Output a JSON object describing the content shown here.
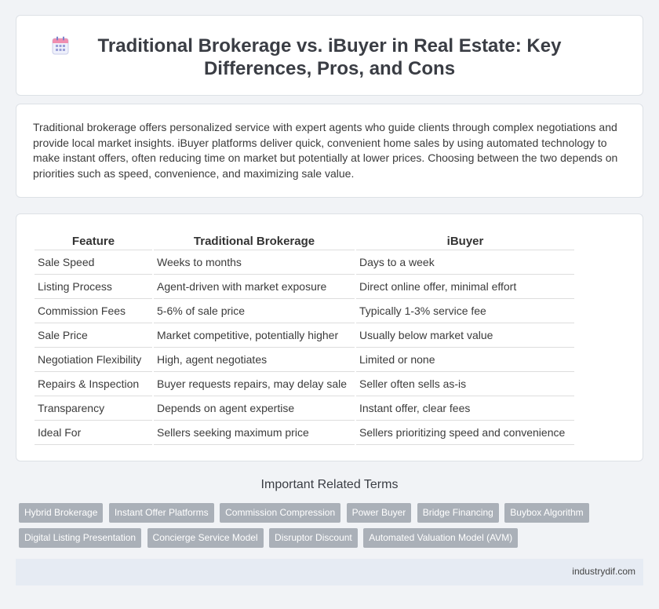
{
  "header": {
    "title": "Traditional Brokerage vs. iBuyer in Real Estate: Key Differences, Pros, and Cons",
    "icon": "calendar-icon"
  },
  "intro": "Traditional brokerage offers personalized service with expert agents who guide clients through complex negotiations and provide local market insights. iBuyer platforms deliver quick, convenient home sales by using automated technology to make instant offers, often reducing time on market but potentially at lower prices. Choosing between the two depends on priorities such as speed, convenience, and maximizing sale value.",
  "table": {
    "headers": [
      "Feature",
      "Traditional Brokerage",
      "iBuyer"
    ],
    "rows": [
      [
        "Sale Speed",
        "Weeks to months",
        "Days to a week"
      ],
      [
        "Listing Process",
        "Agent-driven with market exposure",
        "Direct online offer, minimal effort"
      ],
      [
        "Commission Fees",
        "5-6% of sale price",
        "Typically 1-3% service fee"
      ],
      [
        "Sale Price",
        "Market competitive, potentially higher",
        "Usually below market value"
      ],
      [
        "Negotiation Flexibility",
        "High, agent negotiates",
        "Limited or none"
      ],
      [
        "Repairs & Inspection",
        "Buyer requests repairs, may delay sale",
        "Seller often sells as-is"
      ],
      [
        "Transparency",
        "Depends on agent expertise",
        "Instant offer, clear fees"
      ],
      [
        "Ideal For",
        "Sellers seeking maximum price",
        "Sellers prioritizing speed and convenience"
      ]
    ]
  },
  "related": {
    "title": "Important Related Terms",
    "tags": [
      "Hybrid Brokerage",
      "Instant Offer Platforms",
      "Commission Compression",
      "Power Buyer",
      "Bridge Financing",
      "Buybox Algorithm",
      "Digital Listing Presentation",
      "Concierge Service Model",
      "Disruptor Discount",
      "Automated Valuation Model (AVM)"
    ]
  },
  "footer": {
    "source": "industrydif.com"
  }
}
